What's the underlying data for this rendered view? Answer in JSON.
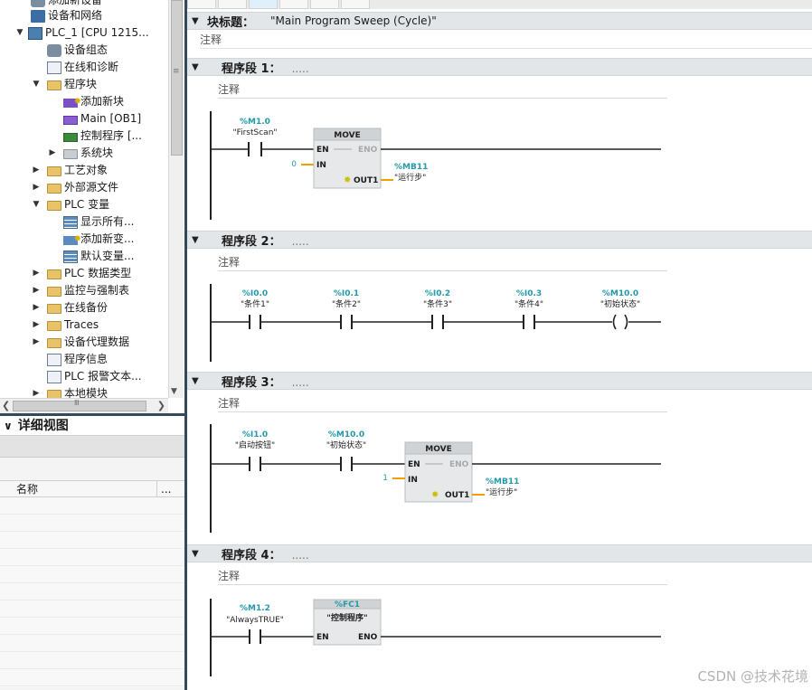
{
  "tree": {
    "items": [
      {
        "label": "添加新设备",
        "icon": "add-device-icon"
      },
      {
        "label": "设备和网络",
        "icon": "network-icon"
      },
      {
        "label": "PLC_1 [CPU 1215...",
        "icon": "cpu-icon"
      },
      {
        "label": "设备组态",
        "icon": "device-config-icon"
      },
      {
        "label": "在线和诊断",
        "icon": "online-diagnostics-icon"
      },
      {
        "label": "程序块",
        "icon": "folder-icon"
      },
      {
        "label": "添加新块",
        "icon": "add-block-icon"
      },
      {
        "label": "Main [OB1]",
        "icon": "ob-block-icon"
      },
      {
        "label": "控制程序 [...",
        "icon": "fc-block-icon"
      },
      {
        "label": "系统块",
        "icon": "system-block-icon"
      },
      {
        "label": "工艺对象",
        "icon": "technology-objects-icon"
      },
      {
        "label": "外部源文件",
        "icon": "external-source-icon"
      },
      {
        "label": "PLC 变量",
        "icon": "folder-icon"
      },
      {
        "label": "显示所有...",
        "icon": "tag-table-icon"
      },
      {
        "label": "添加新变...",
        "icon": "add-tag-table-icon"
      },
      {
        "label": "默认变量...",
        "icon": "tag-table-icon"
      },
      {
        "label": "PLC 数据类型",
        "icon": "data-type-icon"
      },
      {
        "label": "监控与强制表",
        "icon": "watch-table-icon"
      },
      {
        "label": "在线备份",
        "icon": "online-backup-icon"
      },
      {
        "label": "Traces",
        "icon": "traces-icon"
      },
      {
        "label": "设备代理数据",
        "icon": "proxy-data-icon"
      },
      {
        "label": "程序信息",
        "icon": "program-info-icon"
      },
      {
        "label": "PLC 报警文本...",
        "icon": "alarm-text-icon"
      },
      {
        "label": "本地模块",
        "icon": "local-modules-icon"
      }
    ],
    "scroll_grip": "≡",
    "hscroll_grip": "Ⅲ"
  },
  "detail": {
    "title": "详细视图",
    "col_name": "名称",
    "col_more": "..."
  },
  "editor": {
    "block_title_label": "块标题：",
    "block_title_value": "\"Main Program Sweep (Cycle)\"",
    "block_comment": "注释",
    "networks": [
      {
        "title": "程序段 1：",
        "dots": ".....",
        "comment": "注释"
      },
      {
        "title": "程序段 2：",
        "dots": ".....",
        "comment": "注释"
      },
      {
        "title": "程序段 3：",
        "dots": ".....",
        "comment": "注释"
      },
      {
        "title": "程序段 4：",
        "dots": ".....",
        "comment": "注释"
      }
    ],
    "n1": {
      "contact_addr": "%M1.0",
      "contact_sym": "\"FirstScan\"",
      "box_title": "MOVE",
      "en": "EN",
      "eno": "ENO",
      "in": "IN",
      "out": "OUT1",
      "in_value": "0",
      "out_addr": "%MB11",
      "out_sym": "\"运行步\""
    },
    "n2": {
      "contacts": [
        {
          "addr": "%I0.0",
          "sym": "\"条件1\""
        },
        {
          "addr": "%I0.1",
          "sym": "\"条件2\""
        },
        {
          "addr": "%I0.2",
          "sym": "\"条件3\""
        },
        {
          "addr": "%I0.3",
          "sym": "\"条件4\""
        }
      ],
      "coil_addr": "%M10.0",
      "coil_sym": "\"初始状态\""
    },
    "n3": {
      "c1_addr": "%I1.0",
      "c1_sym": "\"启动按钮\"",
      "c2_addr": "%M10.0",
      "c2_sym": "\"初始状态\"",
      "box_title": "MOVE",
      "en": "EN",
      "eno": "ENO",
      "in": "IN",
      "out": "OUT1",
      "in_value": "1",
      "out_addr": "%MB11",
      "out_sym": "\"运行步\""
    },
    "n4": {
      "contact_addr": "%M1.2",
      "contact_sym": "\"AlwaysTRUE\"",
      "call_addr": "%FC1",
      "call_name": "\"控制程序\"",
      "en": "EN",
      "eno": "ENO"
    }
  },
  "watermark": "CSDN @技术花境"
}
